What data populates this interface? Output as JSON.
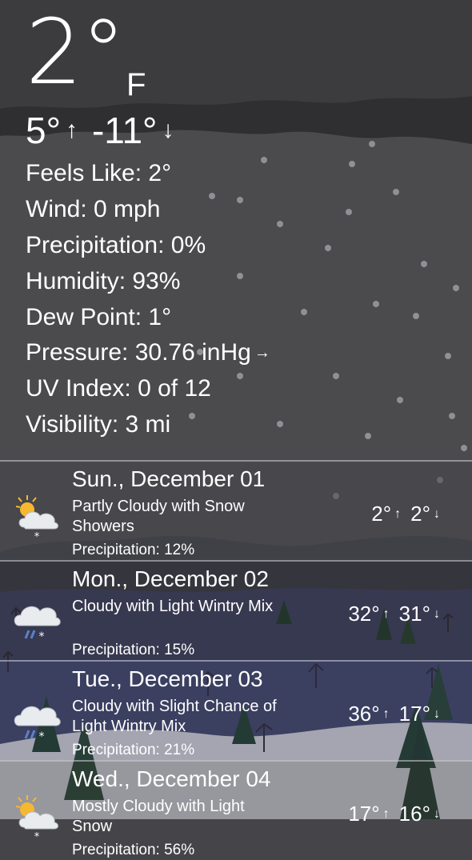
{
  "current": {
    "temperature": "2°",
    "unit": "F",
    "high": "5°",
    "low": "-11°",
    "up_arrow": "↑",
    "down_arrow": "↓",
    "details": [
      "Feels Like: 2°",
      "Wind: 0 mph",
      "Precipitation: 0%",
      "Humidity: 93%",
      "Dew Point: 1°",
      "Pressure: 30.76 inHg",
      "UV Index: 0 of 12",
      "Visibility: 3 mi"
    ],
    "pressure_trend_arrow": "→"
  },
  "forecast": [
    {
      "date": "Sun., December 01",
      "condition": "Partly Cloudy with Snow Showers",
      "precipitation": "Precipitation: 12%",
      "high": "2°",
      "low": "2°",
      "icon": "partly-cloudy-snow-icon"
    },
    {
      "date": "Mon., December 02",
      "condition": "Cloudy with Light Wintry Mix",
      "precipitation": "Precipitation: 15%",
      "high": "32°",
      "low": "31°",
      "icon": "cloudy-wintry-mix-icon"
    },
    {
      "date": "Tue., December 03",
      "condition": "Cloudy with Slight Chance of Light Wintry Mix",
      "precipitation": "Precipitation: 21%",
      "high": "36°",
      "low": "17°",
      "icon": "cloudy-wintry-mix-icon"
    },
    {
      "date": "Wed., December 04",
      "condition": "Mostly Cloudy with Light Snow",
      "precipitation": "Precipitation: 56%",
      "high": "17°",
      "low": "16°",
      "icon": "partly-cloudy-snow-icon"
    }
  ],
  "colors": {
    "sky": "#4a4a4c",
    "cloud_band": "#2e2e30",
    "mountain": "#3e3e4a",
    "field": "#3f4263",
    "snow_ground": "#c9c9cf",
    "tree": "#1f3b2a",
    "sun": "#f5b82e",
    "cloud_icon": "#e9ecef",
    "rain": "#5a82c8"
  }
}
